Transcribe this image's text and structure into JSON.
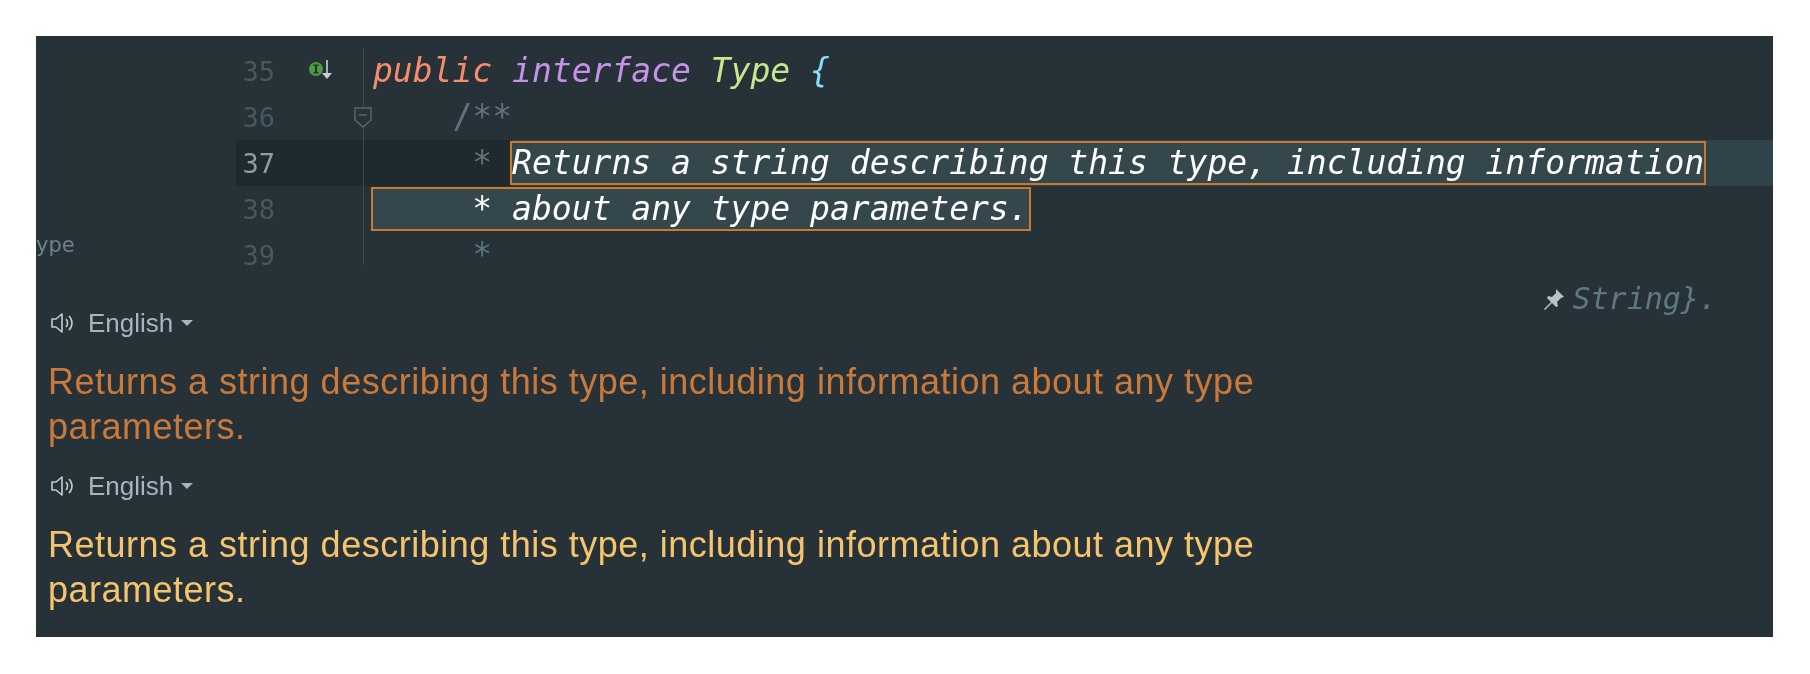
{
  "editor": {
    "side_label": "ype",
    "lines": [
      {
        "number": "35",
        "current": false,
        "implemented": true,
        "foldable": false,
        "tokens": [
          {
            "text": "public ",
            "kind": "keyword"
          },
          {
            "text": "interface ",
            "kind": "modifier"
          },
          {
            "text": "Type ",
            "kind": "type"
          },
          {
            "text": "{",
            "kind": "brace"
          }
        ]
      },
      {
        "number": "36",
        "current": false,
        "implemented": false,
        "foldable": true,
        "tokens": [
          {
            "text": "    /**",
            "kind": "comment"
          }
        ]
      },
      {
        "number": "37",
        "current": true,
        "tokens": [
          {
            "text": "     * ",
            "kind": "comment"
          },
          {
            "text": "Returns a string describing this type, including information",
            "kind": "highlighted"
          }
        ]
      },
      {
        "number": "38",
        "current": false,
        "tokens": [
          {
            "text": "     * about any type parameters.",
            "kind": "highlighted"
          }
        ]
      },
      {
        "number": "39",
        "current": false,
        "tokens": [
          {
            "text": "     *",
            "kind": "comment"
          }
        ]
      }
    ]
  },
  "doc_fragment": "String}.",
  "translations": [
    {
      "language": "English",
      "text": "Returns a string describing this type, including information about any type parameters.",
      "kind": "source"
    },
    {
      "language": "English",
      "text": "Returns a string describing this type, including information about any type parameters.",
      "kind": "result"
    }
  ]
}
